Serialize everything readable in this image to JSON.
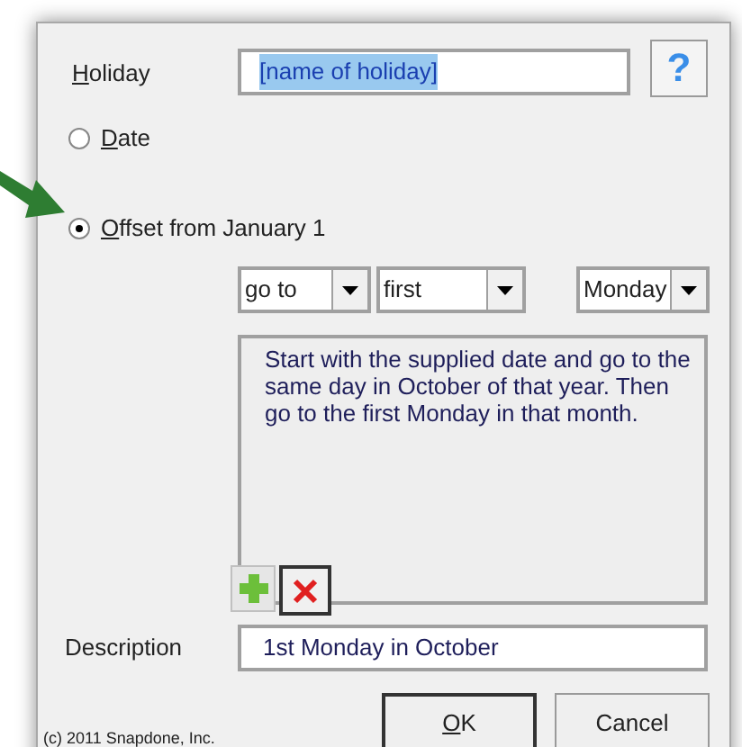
{
  "holiday": {
    "label": "Holiday",
    "mnemonic": true,
    "value": "[name of holiday]",
    "highlighted": true
  },
  "help_button": "?",
  "options": [
    {
      "label": "Date",
      "mnemonic": true,
      "selected": false
    },
    {
      "label": "Offset from January 1",
      "mnemonic": true,
      "selected": true
    }
  ],
  "dropdowns": [
    {
      "value": "go to"
    },
    {
      "value": "first"
    },
    {
      "value": "Monday"
    }
  ],
  "explanation": "Start with the supplied date and go to the same day in October of that year. Then go to the first Monday in that month.",
  "description": {
    "label": "Description",
    "mnemonic": false,
    "value": "1st Monday in October"
  },
  "buttons": [
    {
      "label": "OK",
      "mnemonic": true,
      "default": true
    },
    {
      "label": "Cancel",
      "mnemonic": false,
      "default": false
    }
  ],
  "copyright": "(c) 2011 Snapdone, Inc."
}
